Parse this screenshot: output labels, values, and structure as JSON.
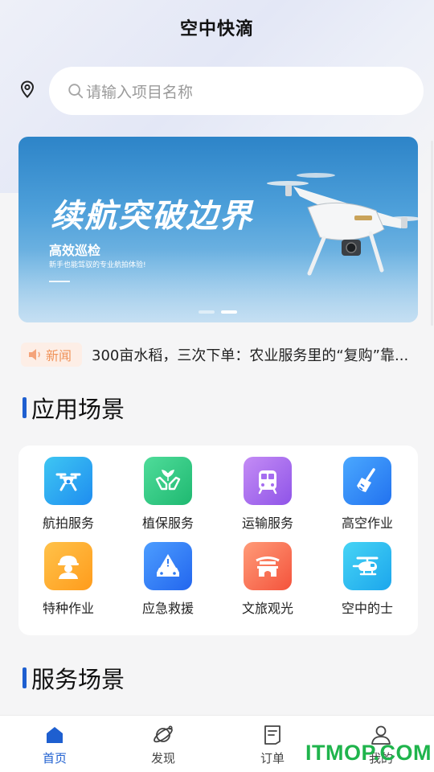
{
  "header": {
    "title": "空中快滴"
  },
  "search": {
    "placeholder": "请输入项目名称"
  },
  "banner": {
    "headline": "续航突破边界",
    "subtitle": "高效巡检",
    "tagline": "新手也能驾驭的专业航拍体验!",
    "slide_count": 2,
    "active_slide": 2
  },
  "news": {
    "badge": "新闻",
    "text": "300亩水稻，三次下单：农业服务里的“复购”靠..."
  },
  "sections": {
    "applications": "应用场景",
    "services": "服务场景"
  },
  "scenes": [
    {
      "label": "航拍服务",
      "icon": "drone-icon",
      "color_from": "#3ec6f2",
      "color_to": "#1f8df0"
    },
    {
      "label": "植保服务",
      "icon": "plant-hands-icon",
      "color_from": "#4fdc9a",
      "color_to": "#1fb971"
    },
    {
      "label": "运输服务",
      "icon": "train-icon",
      "color_from": "#c48cf5",
      "color_to": "#8f54e8"
    },
    {
      "label": "高空作业",
      "icon": "broom-icon",
      "color_from": "#4aa8ff",
      "color_to": "#2272ef"
    },
    {
      "label": "特种作业",
      "icon": "worker-icon",
      "color_from": "#ffc24a",
      "color_to": "#ff9c1c"
    },
    {
      "label": "应急救援",
      "icon": "alert-car-icon",
      "color_from": "#4c9dff",
      "color_to": "#2366ee"
    },
    {
      "label": "文旅观光",
      "icon": "gate-icon",
      "color_from": "#ff9b78",
      "color_to": "#f4533c"
    },
    {
      "label": "空中的士",
      "icon": "helicopter-icon",
      "color_from": "#46d4f5",
      "color_to": "#1ca6ec"
    }
  ],
  "tabbar": [
    {
      "label": "首页",
      "icon": "home-icon",
      "active": true
    },
    {
      "label": "发现",
      "icon": "planet-icon",
      "active": false
    },
    {
      "label": "订单",
      "icon": "order-icon",
      "active": false
    },
    {
      "label": "我的",
      "icon": "user-icon",
      "active": false
    }
  ],
  "watermark": "ITMOP.COM",
  "colors": {
    "accent": "#1e5fd0",
    "news": "#f0935a",
    "watermark": "#1fb44c"
  }
}
